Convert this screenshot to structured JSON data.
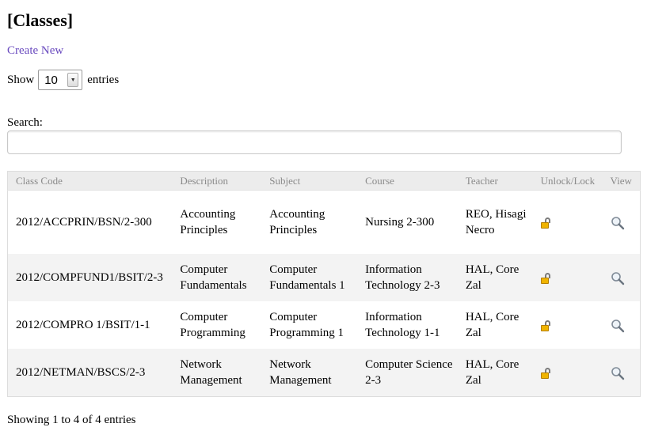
{
  "page_title": "[Classes]",
  "create_new_label": "Create New",
  "length": {
    "show_label": "Show",
    "selected": "10",
    "entries_label": "entries"
  },
  "search": {
    "label": "Search:",
    "value": ""
  },
  "table": {
    "columns": [
      "Class Code",
      "Description",
      "Subject",
      "Course",
      "Teacher",
      "Unlock/Lock",
      "View"
    ],
    "rows": [
      {
        "class_code": "2012/ACCPRIN/BSN/2-300",
        "description": "Accounting Principles",
        "subject": "Accounting Principles",
        "course": "Nursing 2-300",
        "teacher": "REO, Hisagi Necro",
        "lock_icon": "unlock-icon",
        "view_icon": "magnifier-icon"
      },
      {
        "class_code": "2012/COMPFUND1/BSIT/2-3",
        "description": "Computer Fundamentals",
        "subject": "Computer Fundamentals 1",
        "course": "Information Technology 2-3",
        "teacher": "HAL, Core Zal",
        "lock_icon": "unlock-icon",
        "view_icon": "magnifier-icon"
      },
      {
        "class_code": "2012/COMPRO 1/BSIT/1-1",
        "description": "Computer Programming",
        "subject": "Computer Programming 1",
        "course": "Information Technology 1-1",
        "teacher": "HAL, Core Zal",
        "lock_icon": "unlock-icon",
        "view_icon": "magnifier-icon"
      },
      {
        "class_code": "2012/NETMAN/BSCS/2-3",
        "description": "Network Management",
        "subject": "Network Management",
        "course": "Computer Science 2-3",
        "teacher": "HAL, Core Zal",
        "lock_icon": "unlock-icon",
        "view_icon": "magnifier-icon"
      }
    ]
  },
  "info_text": "Showing 1 to 4 of 4 entries",
  "colors": {
    "link": "#6a4bbf",
    "header_bg": "#ececec",
    "header_text": "#8a8a8a",
    "alt_row_bg": "#f3f3f3",
    "lock_gold": "#f0b400"
  }
}
